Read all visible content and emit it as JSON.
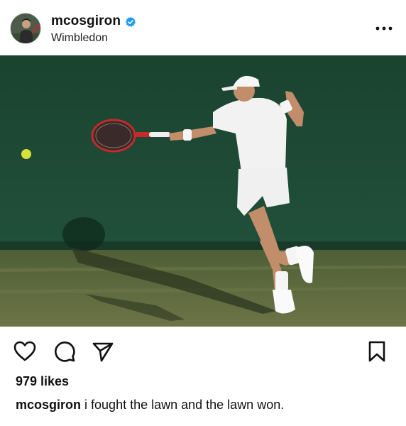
{
  "post": {
    "username": "mcosgiron",
    "verified": true,
    "location": "Wimbledon",
    "likes": "979 likes",
    "caption_user": "mcosgiron",
    "caption_text": "i fought the lawn and the lawn won."
  },
  "icons": {
    "more": "more-options-icon",
    "verified": "verified-badge-icon",
    "like": "heart-icon",
    "comment": "comment-icon",
    "share": "send-icon",
    "save": "bookmark-icon"
  },
  "colors": {
    "verified": "#1d9bf0",
    "wall": "#1f4632",
    "grass": "#5c6a3e"
  }
}
